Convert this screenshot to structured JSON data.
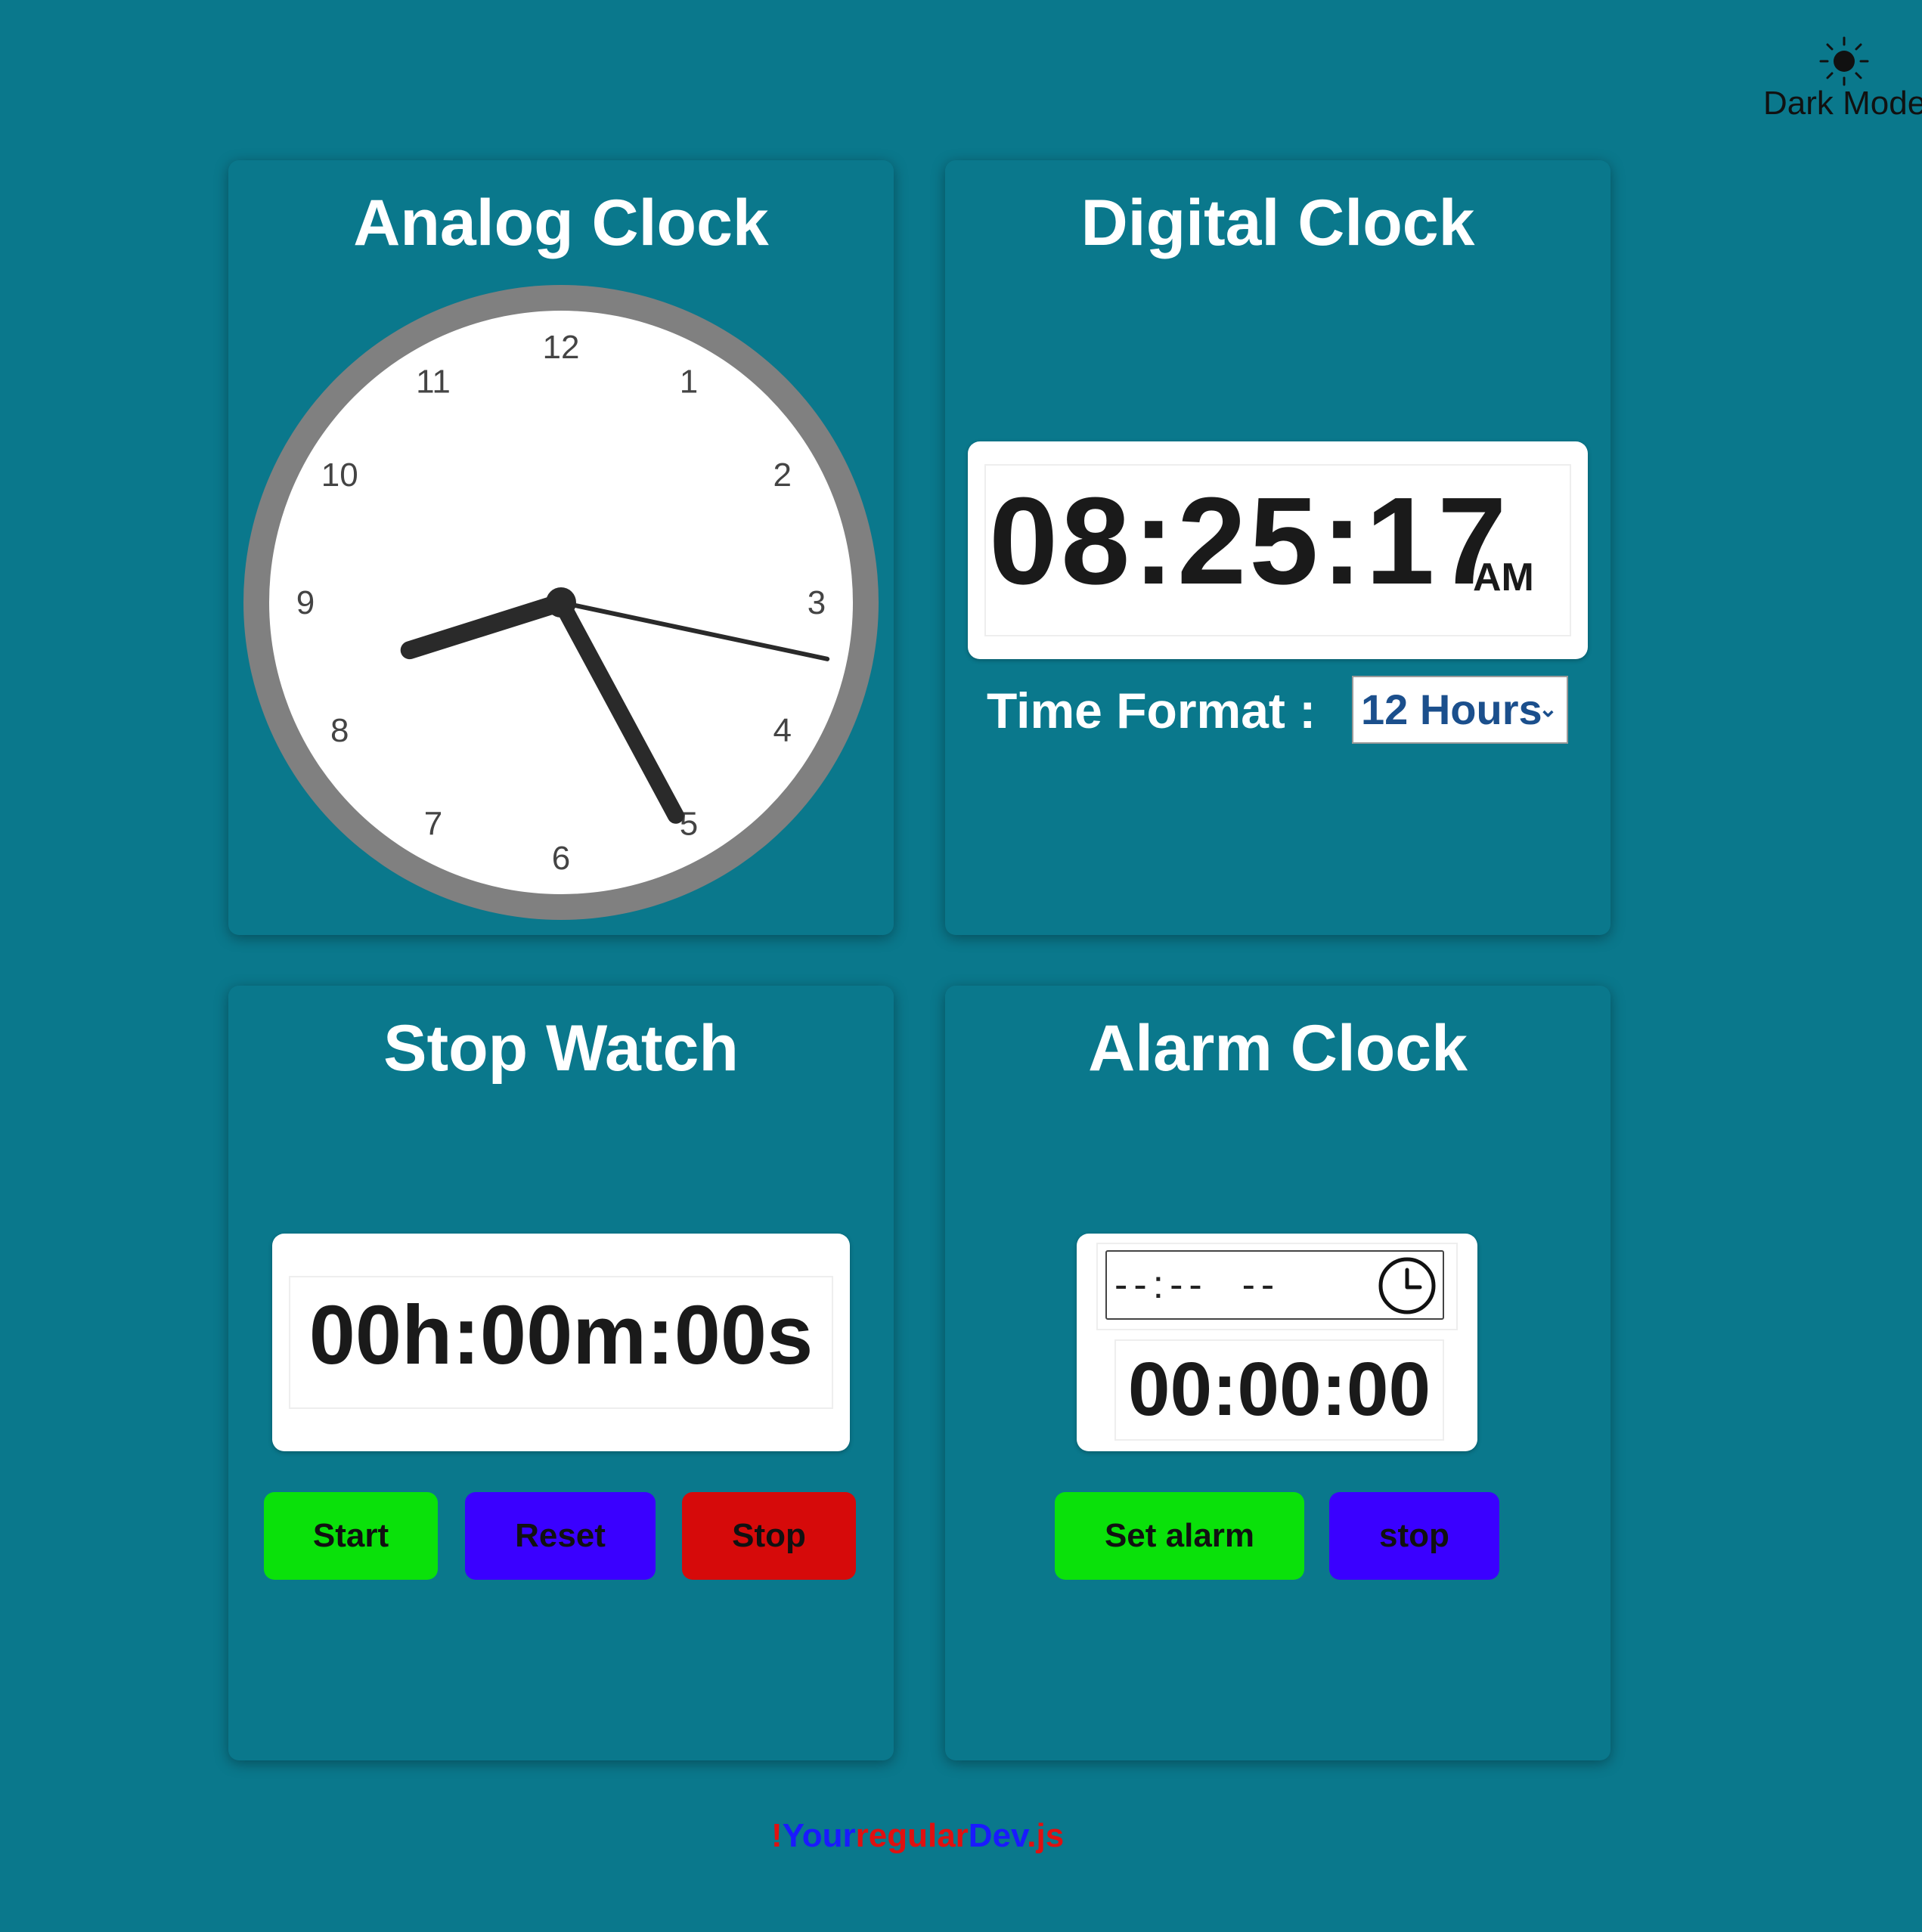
{
  "theme": {
    "label": "Dark Mode",
    "icon": "sun-icon"
  },
  "analog": {
    "title": "Analog Clock",
    "numbers": [
      "12",
      "1",
      "2",
      "3",
      "4",
      "5",
      "6",
      "7",
      "8",
      "9",
      "10",
      "11"
    ],
    "time": {
      "hours": 8,
      "minutes": 25,
      "seconds": 17
    }
  },
  "digital": {
    "title": "Digital Clock",
    "time": "08:25:17",
    "ampm": "AM",
    "format_label": "Time Format :",
    "format_value": "12 Hours"
  },
  "stopwatch": {
    "title": "Stop Watch",
    "display": "00h:00m:00s",
    "start_label": "Start",
    "reset_label": "Reset",
    "stop_label": "Stop"
  },
  "alarm": {
    "title": "Alarm Clock",
    "input_placeholder": "--:--  --",
    "countdown": "00:00:00",
    "set_label": "Set alarm",
    "stop_label": "stop"
  },
  "footer": {
    "parts": [
      {
        "text": "!",
        "color": "#e01010"
      },
      {
        "text": "Your",
        "color": "#1a1aff"
      },
      {
        "text": "regular",
        "color": "#e01010"
      },
      {
        "text": "Dev",
        "color": "#1a1aff"
      },
      {
        "text": ".js",
        "color": "#e01010"
      }
    ]
  },
  "colors": {
    "background": "#0a788c",
    "green": "#0ae10a",
    "blue": "#3a00ff",
    "red": "#d60a0a"
  }
}
